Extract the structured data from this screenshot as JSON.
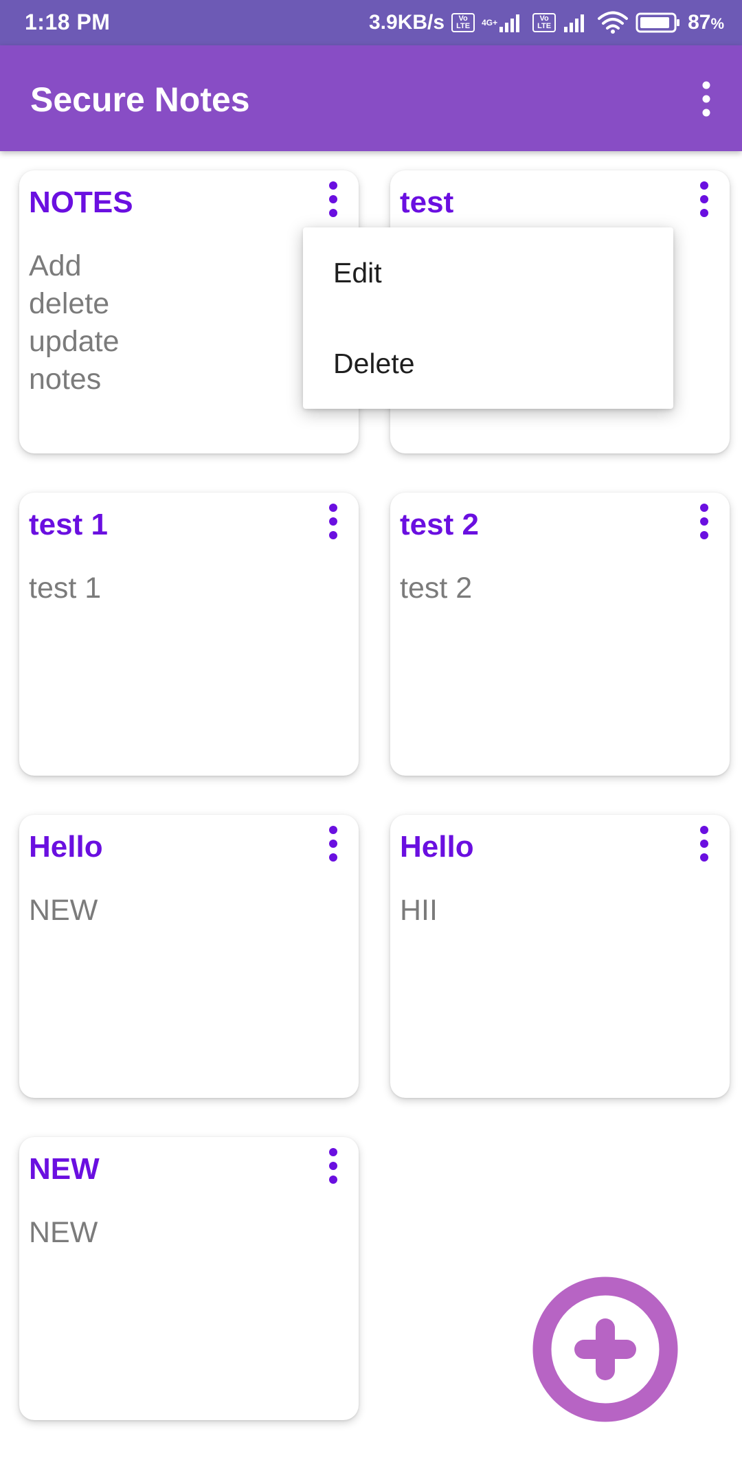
{
  "status_bar": {
    "time": "1:18 PM",
    "network_speed": "3.9KB/s",
    "sim1_volte": "Vo LTE",
    "sim1_network": "4G+",
    "sim2_volte": "Vo LTE",
    "battery": "87",
    "battery_unit": "%"
  },
  "app_bar": {
    "title": "Secure Notes"
  },
  "notes": [
    {
      "title": "NOTES",
      "body": "Add\ndelete\nupdate\nnotes"
    },
    {
      "title": "test",
      "body": ""
    },
    {
      "title": "test 1",
      "body": "test 1"
    },
    {
      "title": "test 2",
      "body": "test 2"
    },
    {
      "title": "Hello",
      "body": "NEW"
    },
    {
      "title": "Hello",
      "body": "HII"
    },
    {
      "title": "NEW",
      "body": "NEW"
    }
  ],
  "popup_menu": {
    "items": [
      {
        "label": "Edit"
      },
      {
        "label": "Delete"
      }
    ]
  },
  "colors": {
    "status_bar": "#6d5ab5",
    "app_bar": "#884dc5",
    "note_title": "#6a0fe0",
    "note_body": "#7b7b7b",
    "fab": "#b764c4"
  },
  "icons": {
    "overflow": "more-vert-icon",
    "fab": "add-circle-icon"
  }
}
